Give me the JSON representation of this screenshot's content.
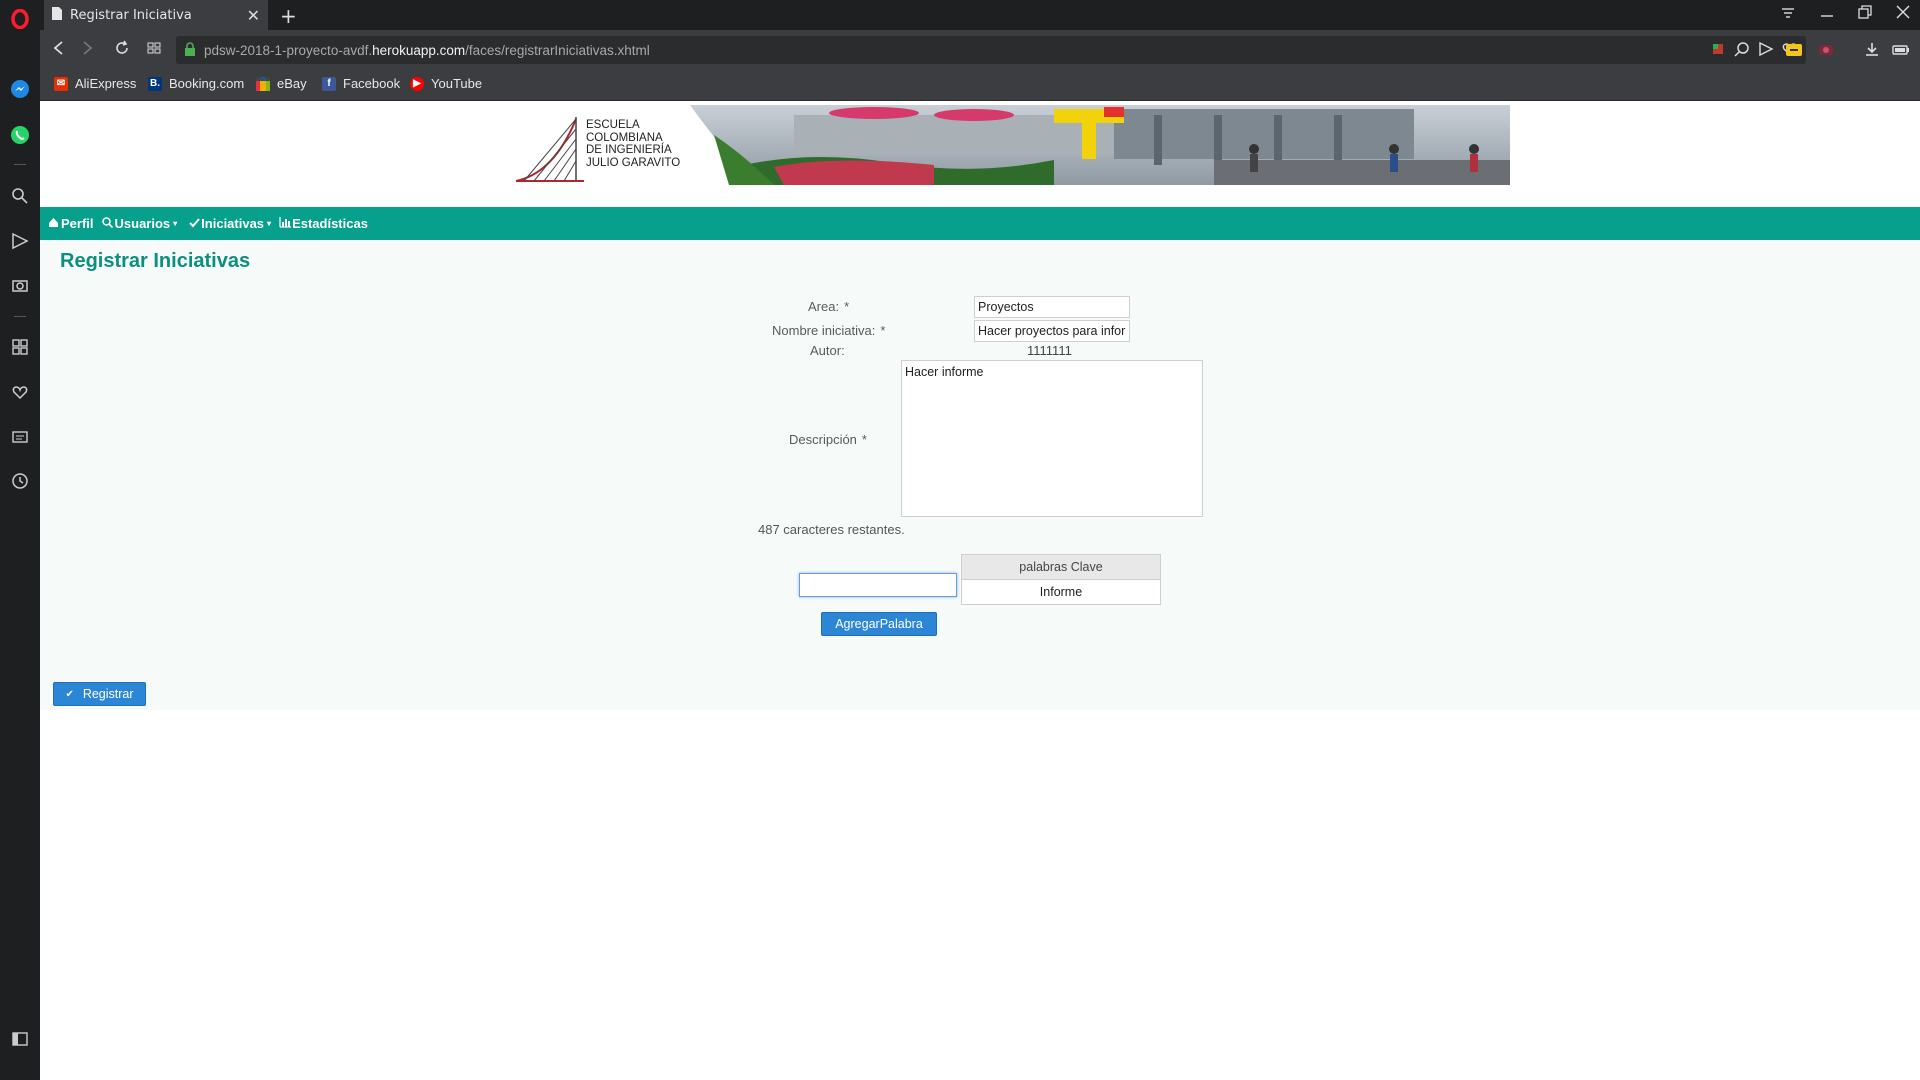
{
  "browser": {
    "tab_title": "Registrar Iniciativa",
    "new_tab_symbol": "+",
    "close_symbol": "✕",
    "url_prefix": "pdsw-2018-1-proyecto-avdf.",
    "url_host": "herokuapp.com",
    "url_path": "/faces/registrarIniciativas.xhtml"
  },
  "bookmarks": [
    {
      "label": "AliExpress",
      "icon": "aliexpress-icon",
      "color": "#e62e04"
    },
    {
      "label": "Booking.com",
      "icon": "booking-icon",
      "color": "#003580"
    },
    {
      "label": "eBay",
      "icon": "ebay-icon",
      "color": "#e53238"
    },
    {
      "label": "Facebook",
      "icon": "facebook-icon",
      "color": "#3b5998"
    },
    {
      "label": "YouTube",
      "icon": "youtube-icon",
      "color": "#ff0000"
    }
  ],
  "banner": {
    "line1": "ESCUELA",
    "line2": "COLOMBIANA",
    "line3": "DE INGENIERÍA",
    "line4": "JULIO GARAVITO"
  },
  "menu": {
    "perfil": "Perfil",
    "usuarios": "Usuarios",
    "iniciativas": "Iniciativas",
    "estadisticas": "Estadísticas",
    "accent_color": "#06a08c"
  },
  "form": {
    "title": "Registrar Iniciativas",
    "area_label": "Area:",
    "area_value": "Proyectos",
    "nombre_label": "Nombre iniciativa:",
    "nombre_value": "Hacer proyectos para infor",
    "autor_label": "Autor:",
    "autor_value": "1111111",
    "descripcion_label": "Descripción",
    "descripcion_value": "Hacer informe",
    "required_mark": "*",
    "remaining_text": "487 caracteres restantes.",
    "keywords_header": "palabras Clave",
    "keywords": [
      "Informe"
    ],
    "keyword_input_value": "",
    "add_word_button": "AgregarPalabra",
    "submit_button": "Registrar",
    "submit_icon": "✔"
  }
}
